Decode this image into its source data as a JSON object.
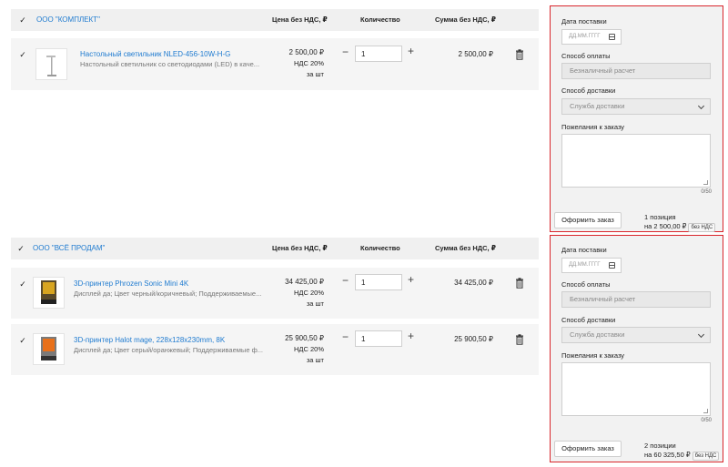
{
  "columns": {
    "price": "Цена без НДС, ₽",
    "qty": "Количество",
    "sum": "Сумма без НДС, ₽"
  },
  "icons": {
    "checkbox": "check-icon",
    "minus": "minus-icon",
    "plus": "plus-icon",
    "trash": "trash-icon",
    "calendar": "calendar-icon",
    "chevron": "chevron-down-icon"
  },
  "accent_color": "#1f7bd0",
  "panel_border_color": "#d9262c",
  "groups": [
    {
      "vendor": "ООО \"КОМПЛЕКТ\"",
      "items": [
        {
          "name": "Настольный светильник NLED-456-10W-H-G",
          "desc": "Настольный светильник со светодиодами (LED) в каче...",
          "price": "2 500,00 ₽",
          "vat": "НДС 20%",
          "unit": "за шт",
          "qty": "1",
          "sum": "2 500,00 ₽"
        }
      ],
      "panel": {
        "date_label": "Дата поставки",
        "date_placeholder": "ДД.ММ.ГГГГ",
        "payment_label": "Способ оплаты",
        "payment_value": "Безналичный расчет",
        "delivery_label": "Способ доставки",
        "delivery_value": "Служба доставки",
        "wishes_label": "Пожелания к заказу",
        "counter": "0/50",
        "order_button": "Оформить заказ",
        "positions": "1 позиция",
        "total": "на 2 500,00 ₽",
        "badge": "без НДС"
      }
    },
    {
      "vendor": "ООО \"ВСЁ ПРОДАМ\"",
      "items": [
        {
          "name": "3D-принтер Phrozen Sonic Mini 4K",
          "desc": "Дисплей да; Цвет черный/коричневый; Поддерживаемые...",
          "price": "34 425,00 ₽",
          "vat": "НДС 20%",
          "unit": "за шт",
          "qty": "1",
          "sum": "34 425,00 ₽"
        },
        {
          "name": "3D-принтер Halot mage, 228x128x230mm, 8K",
          "desc": "Дисплей да; Цвет серый/оранжевый; Поддерживаемые ф...",
          "price": "25 900,50 ₽",
          "vat": "НДС 20%",
          "unit": "за шт",
          "qty": "1",
          "sum": "25 900,50 ₽"
        }
      ],
      "panel": {
        "date_label": "Дата поставки",
        "date_placeholder": "ДД.ММ.ГГГГ",
        "payment_label": "Способ оплаты",
        "payment_value": "Безналичный расчет",
        "delivery_label": "Способ доставки",
        "delivery_value": "Служба доставки",
        "wishes_label": "Пожелания к заказу",
        "counter": "0/50",
        "order_button": "Оформить заказ",
        "positions": "2 позиции",
        "total": "на 60 325,50 ₽",
        "badge": "без НДС"
      }
    }
  ]
}
